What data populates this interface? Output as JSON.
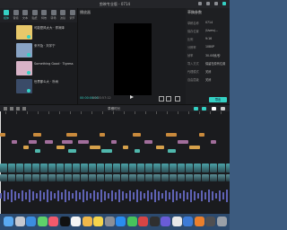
{
  "app": {
    "title": "剪映专业版 - 0714"
  },
  "toolbar": {
    "tools": [
      "媒体",
      "音频",
      "文本",
      "贴纸",
      "特效",
      "转场",
      "滤镜",
      "调节"
    ]
  },
  "library": {
    "items": [
      {
        "text": "可能是风太大 · 郑润泽",
        "thumb": "#e8c86a"
      },
      {
        "text": "来不及 · 刘宇宁",
        "thumb": "#88a3c4"
      },
      {
        "text": "Something Good · Tigress",
        "thumb": "#d8b3c7"
      },
      {
        "text": "世界那么大 · 朴树",
        "thumb": "#3a4b68"
      }
    ],
    "side_item": "Something Good · The Foxes"
  },
  "player": {
    "title": "播放器",
    "time_current": "00:00:00:00",
    "time_total": "00:03:57:12"
  },
  "properties": {
    "title": "草稿参数",
    "rows": [
      {
        "label": "草稿名称",
        "value": "0714"
      },
      {
        "label": "保存位置",
        "value": "/Users/..."
      },
      {
        "label": "比例",
        "value": "9:16"
      },
      {
        "label": "分辨率",
        "value": "1080P"
      },
      {
        "label": "帧率",
        "value": "30.00帧/秒"
      },
      {
        "label": "导入方式",
        "value": "保留在原有位置"
      },
      {
        "label": "代理模式",
        "value": "关闭"
      },
      {
        "label": "自由层级",
        "value": "关闭"
      }
    ],
    "export_label": "导出"
  },
  "timeline": {
    "label": "草稿时长"
  },
  "dock": {
    "icons": [
      {
        "name": "finder-icon",
        "color": "#5aa9f0"
      },
      {
        "name": "launchpad-icon",
        "color": "#c6c9d0"
      },
      {
        "name": "safari-icon",
        "color": "#3c8de0"
      },
      {
        "name": "messages-icon",
        "color": "#5fd06a"
      },
      {
        "name": "music-icon",
        "color": "#f25a6c"
      },
      {
        "name": "tiktok-icon",
        "color": "#111111"
      },
      {
        "name": "capcut-icon",
        "color": "#f4f4f4"
      },
      {
        "name": "photos-icon",
        "color": "#f0b84a"
      },
      {
        "name": "notes-icon",
        "color": "#f6d54b"
      },
      {
        "name": "settings-icon",
        "color": "#8b8f96"
      },
      {
        "name": "appstore-icon",
        "color": "#2a8cf0"
      },
      {
        "name": "wechat-icon",
        "color": "#47c35c"
      },
      {
        "name": "app-icon",
        "color": "#d64545"
      },
      {
        "name": "app-icon",
        "color": "#2f2f2f"
      },
      {
        "name": "app-icon",
        "color": "#6a5cd8"
      },
      {
        "name": "app-icon",
        "color": "#e8e8e8"
      },
      {
        "name": "app-icon",
        "color": "#3d7bd6"
      },
      {
        "name": "app-icon",
        "color": "#eb7f2c"
      },
      {
        "name": "app-icon",
        "color": "#4f4f52"
      },
      {
        "name": "trash-icon",
        "color": "#9aa0a8"
      }
    ]
  }
}
